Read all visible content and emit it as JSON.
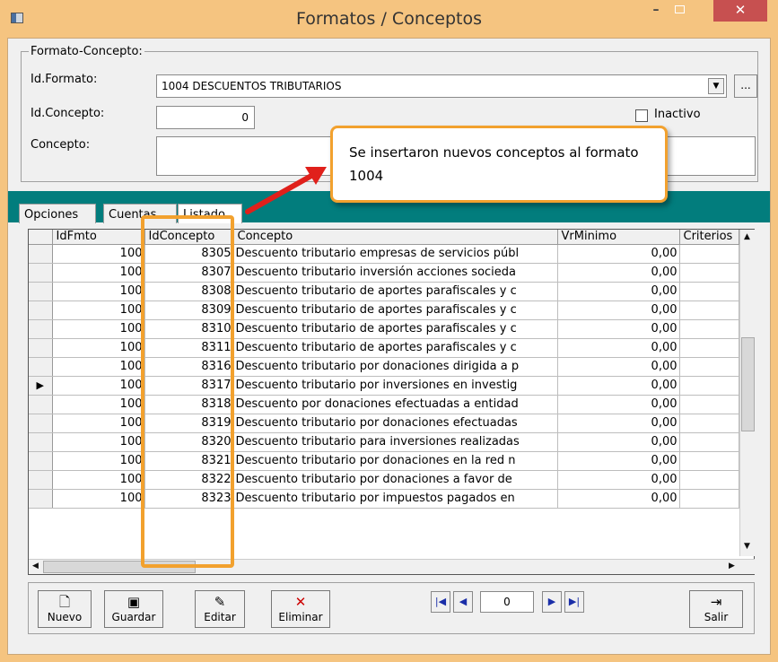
{
  "window": {
    "title": "Formatos / Conceptos",
    "min": "–",
    "close": "✕"
  },
  "group": {
    "legend": "Formato-Concepto:",
    "id_formato_label": "Id.Formato:",
    "id_formato_value": "1004 DESCUENTOS TRIBUTARIOS",
    "dots": "...",
    "id_concepto_label": "Id.Concepto:",
    "id_concepto_value": "0",
    "inactivo_label": "Inactivo",
    "concepto_label": "Concepto:"
  },
  "tabs": [
    "Opciones",
    "Cuentas",
    "Listado"
  ],
  "grid": {
    "columns": [
      "IdFmto",
      "IdConcepto",
      "Concepto",
      "VrMinimo",
      "Criterios"
    ],
    "rows": [
      [
        "100",
        "8305",
        "Descuento tributario empresas de servicios públ",
        "0,00"
      ],
      [
        "100",
        "8307",
        "Descuento tributario inversión acciones socieda",
        "0,00"
      ],
      [
        "100",
        "8308",
        "Descuento tributario de aportes parafiscales y c",
        "0,00"
      ],
      [
        "100",
        "8309",
        "Descuento tributario de aportes parafiscales y c",
        "0,00"
      ],
      [
        "100",
        "8310",
        "Descuento tributario de aportes parafiscales y c",
        "0,00"
      ],
      [
        "100",
        "8311",
        "Descuento tributario de aportes parafiscales y c",
        "0,00"
      ],
      [
        "100",
        "8316",
        "Descuento tributario por donaciones dirigida a p",
        "0,00"
      ],
      [
        "100",
        "8317",
        "Descuento tributario por inversiones en investig",
        "0,00"
      ],
      [
        "100",
        "8318",
        "Descuento por donaciones efectuadas a entidad",
        "0,00"
      ],
      [
        "100",
        "8319",
        "Descuento tributario por donaciones efectuadas",
        "0,00"
      ],
      [
        "100",
        "8320",
        "Descuento tributario para inversiones realizadas",
        "0,00"
      ],
      [
        "100",
        "8321",
        "Descuento tributario por donaciones en la red n",
        "0,00"
      ],
      [
        "100",
        "8322",
        "Descuento tributario por donaciones a favor de",
        "0,00"
      ],
      [
        "100",
        "8323",
        "Descuento tributario por impuestos pagados en",
        "0,00"
      ]
    ],
    "selected_row_marker": "▶"
  },
  "toolbar": {
    "nuevo": "Nuevo",
    "guardar": "Guardar",
    "editar": "Editar",
    "eliminar": "Eliminar",
    "salir": "Salir",
    "nav_value": "0"
  },
  "callout": {
    "text": "Se insertaron nuevos conceptos al formato 1004"
  },
  "colors": {
    "accent": "#f2a12e",
    "teal": "#027d7d",
    "title": "#f5c480"
  }
}
